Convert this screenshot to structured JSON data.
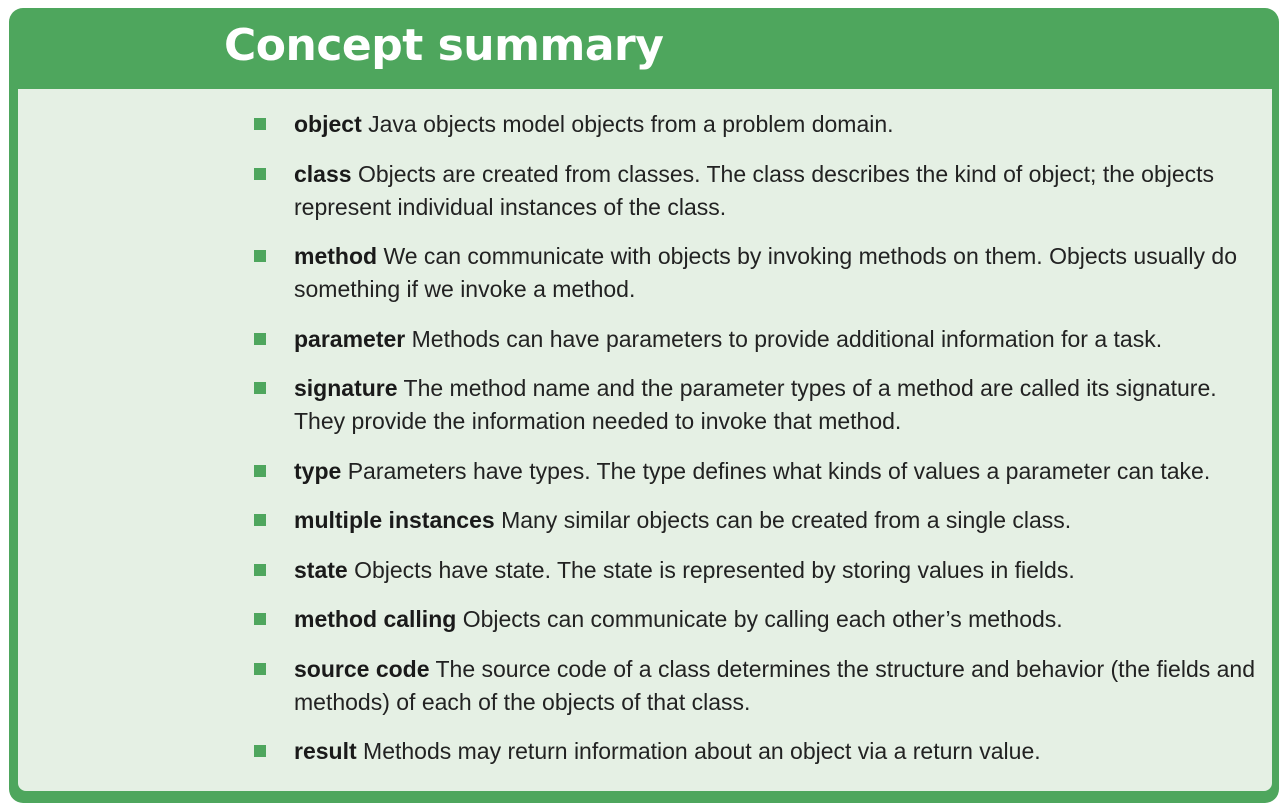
{
  "title": "Concept summary",
  "concepts": [
    {
      "term": "object",
      "text": "Java objects model objects from a problem domain."
    },
    {
      "term": "class",
      "text": "Objects are created from classes. The class describes the kind of object; the objects represent individual instances of the class."
    },
    {
      "term": "method",
      "text": "We can communicate with objects by invoking methods on them. Objects usually do something if we invoke a method."
    },
    {
      "term": "parameter",
      "text": "Methods can have parameters to provide additional information for a task."
    },
    {
      "term": "signature",
      "text": "The method name and the parameter types of a method are called its signature. They provide the information needed to invoke that method."
    },
    {
      "term": "type",
      "text": "Parameters have types. The type defines what kinds of values a parameter can take."
    },
    {
      "term": "multiple instances",
      "text": "Many similar objects can be created from a single class."
    },
    {
      "term": "state",
      "text": "Objects have state. The state is represented by storing values in fields."
    },
    {
      "term": "method calling",
      "text": "Objects can communicate by calling each other’s methods."
    },
    {
      "term": "source code",
      "text": "The source code of a class determines the structure and behavior (the fields and methods) of each of the objects of that class."
    },
    {
      "term": "result",
      "text": "Methods may return information about an object via a return value."
    }
  ],
  "colors": {
    "frame": "#4ea65d",
    "panel": "#e5f0e4",
    "bullet": "#4ea65d"
  }
}
